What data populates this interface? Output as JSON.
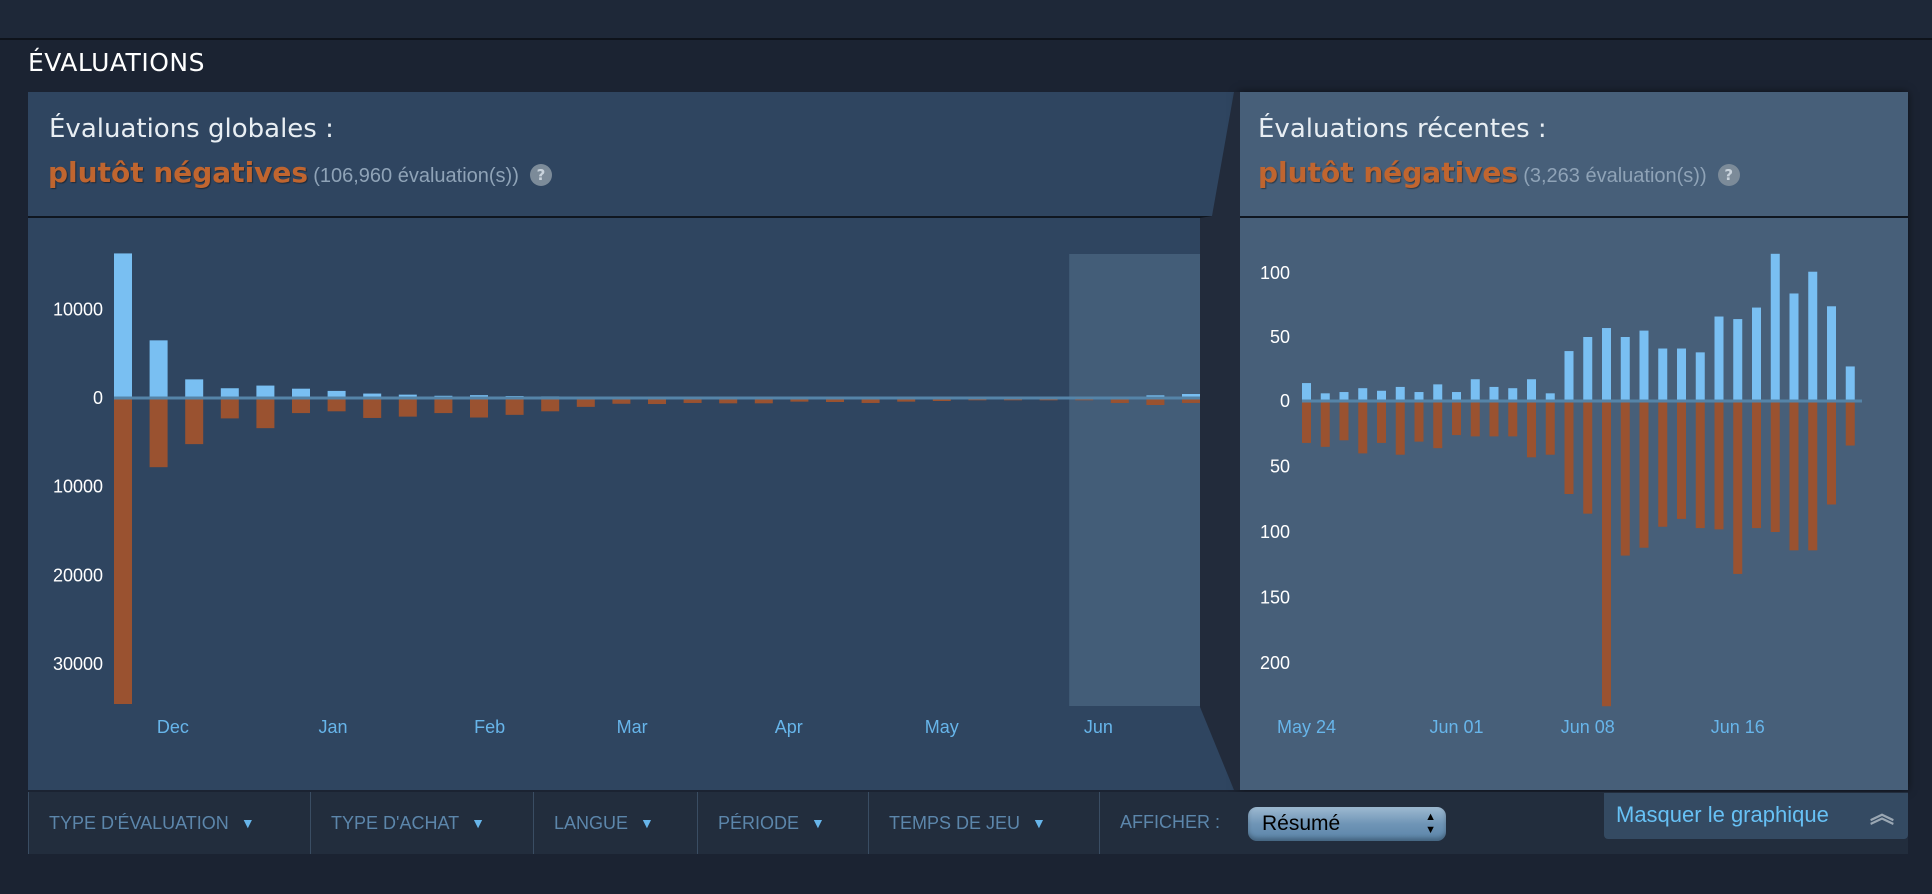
{
  "section_title": "ÉVALUATIONS",
  "overall": {
    "label": "Évaluations globales :",
    "rating": "plutôt négatives",
    "count": "(106,960 évaluation(s))",
    "help_icon": "?"
  },
  "recent": {
    "label": "Évaluations récentes :",
    "rating": "plutôt négatives",
    "count": "(3,263 évaluation(s))",
    "help_icon": "?"
  },
  "filters": [
    {
      "label": "TYPE D'ÉVALUATION"
    },
    {
      "label": "TYPE D'ACHAT"
    },
    {
      "label": "LANGUE"
    },
    {
      "label": "PÉRIODE"
    },
    {
      "label": "TEMPS DE JEU"
    }
  ],
  "display": {
    "label": "AFFICHER :",
    "selected": "Résumé"
  },
  "hide_graph": {
    "label": "Masquer le graphique",
    "icon": "double-chevron-up-icon"
  },
  "colors": {
    "positive": "#79bff2",
    "negative": "#9a5230",
    "rating": "#c0652f",
    "accent": "#67c1f5"
  },
  "chart_data": [
    {
      "type": "bar",
      "stacked_diverging": true,
      "y_ticks": [
        {
          "value": 10000,
          "label": "10000"
        },
        {
          "value": 0,
          "label": "0"
        },
        {
          "value": -10000,
          "label": "10000"
        },
        {
          "value": -20000,
          "label": "20000"
        },
        {
          "value": -30000,
          "label": "30000"
        }
      ],
      "x_ticks": [
        {
          "bar": 1.4,
          "label": "Dec"
        },
        {
          "bar": 5.9,
          "label": "Jan"
        },
        {
          "bar": 10.3,
          "label": "Feb"
        },
        {
          "bar": 14.3,
          "label": "Mar"
        },
        {
          "bar": 18.7,
          "label": "Apr"
        },
        {
          "bar": 23,
          "label": "May"
        },
        {
          "bar": 27.4,
          "label": "Jun"
        }
      ],
      "highlight_bars": [
        27,
        30
      ],
      "ylim": [
        -34500,
        16300
      ],
      "series": [
        {
          "sign": "positive",
          "values": [
            16300,
            6500,
            2100,
            1100,
            1400,
            1050,
            800,
            500,
            380,
            250,
            320,
            220,
            180,
            80,
            50,
            100,
            80,
            150,
            80,
            60,
            60,
            60,
            60,
            60,
            40,
            40,
            40,
            40,
            150,
            300,
            450
          ]
        },
        {
          "sign": "negative",
          "values": [
            34500,
            7800,
            5200,
            2300,
            3400,
            1700,
            1500,
            2250,
            2100,
            1700,
            2200,
            1900,
            1500,
            1000,
            650,
            680,
            560,
            600,
            600,
            410,
            450,
            560,
            410,
            340,
            260,
            260,
            260,
            260,
            560,
            790,
            560
          ]
        }
      ]
    },
    {
      "type": "bar",
      "stacked_diverging": true,
      "y_ticks": [
        {
          "value": 100,
          "label": "100"
        },
        {
          "value": 50,
          "label": "50"
        },
        {
          "value": 0,
          "label": "0"
        },
        {
          "value": -50,
          "label": "50"
        },
        {
          "value": -100,
          "label": "100"
        },
        {
          "value": -150,
          "label": "150"
        },
        {
          "value": -200,
          "label": "200"
        }
      ],
      "x_ticks": [
        {
          "bar": 0,
          "label": "May 24"
        },
        {
          "bar": 8,
          "label": "Jun 01"
        },
        {
          "bar": 15,
          "label": "Jun 08"
        },
        {
          "bar": 23,
          "label": "Jun 16"
        }
      ],
      "ylim": [
        -233,
        115
      ],
      "series": [
        {
          "sign": "positive",
          "values": [
            14,
            6,
            7,
            10,
            8,
            11,
            7,
            13,
            7,
            17,
            11,
            10,
            17,
            6,
            39,
            50,
            57,
            50,
            55,
            41,
            41,
            38,
            66,
            64,
            73,
            115,
            84,
            101,
            74,
            27
          ]
        },
        {
          "sign": "negative",
          "values": [
            32,
            35,
            30,
            40,
            32,
            41,
            31,
            36,
            26,
            27,
            27,
            27,
            43,
            41,
            71,
            86,
            233,
            118,
            112,
            96,
            90,
            97,
            98,
            132,
            97,
            100,
            114,
            114,
            79,
            34
          ]
        }
      ]
    }
  ]
}
